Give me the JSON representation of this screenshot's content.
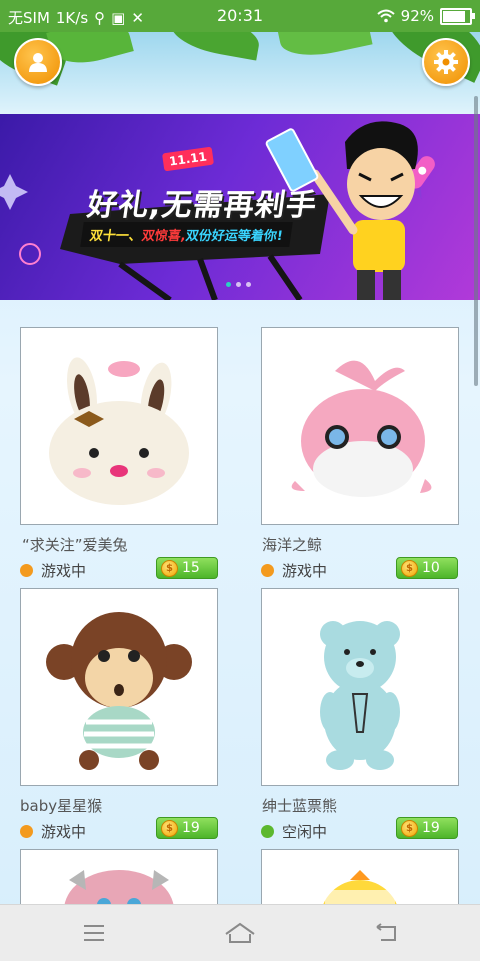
{
  "statusbar": {
    "carrier": "无SIM",
    "speed": "1K/s",
    "time": "20:31",
    "battery": "92%",
    "battery_level": 0.92
  },
  "header": {
    "profile_icon": "user-icon",
    "settings_icon": "gear-icon"
  },
  "banner": {
    "badge": "11.11",
    "title": "好礼,无需再剁手",
    "subtitle_part1": "双十一、",
    "subtitle_part2": "双惊喜,",
    "subtitle_part3": "双份好运等着你!",
    "slide_count": 3,
    "active_slide": 0
  },
  "items": [
    {
      "name": "“求关注”爱美兔",
      "status": "游戏中",
      "status_color": "#f39a1e",
      "price": "15"
    },
    {
      "name": "海洋之鲸",
      "status": "游戏中",
      "status_color": "#f39a1e",
      "price": "10"
    },
    {
      "name": "baby星星猴",
      "status": "游戏中",
      "status_color": "#f39a1e",
      "price": "19"
    },
    {
      "name": "绅士蓝票熊",
      "status": "空闲中",
      "status_color": "#5cb82e",
      "price": "19"
    }
  ],
  "colors": {
    "statusbar": "#57a93a",
    "accent_orange": "#f08f00",
    "button_green": "#4db52a"
  },
  "navbar": {
    "menu_icon": "menu-icon",
    "home_icon": "home-icon",
    "back_icon": "back-icon"
  }
}
